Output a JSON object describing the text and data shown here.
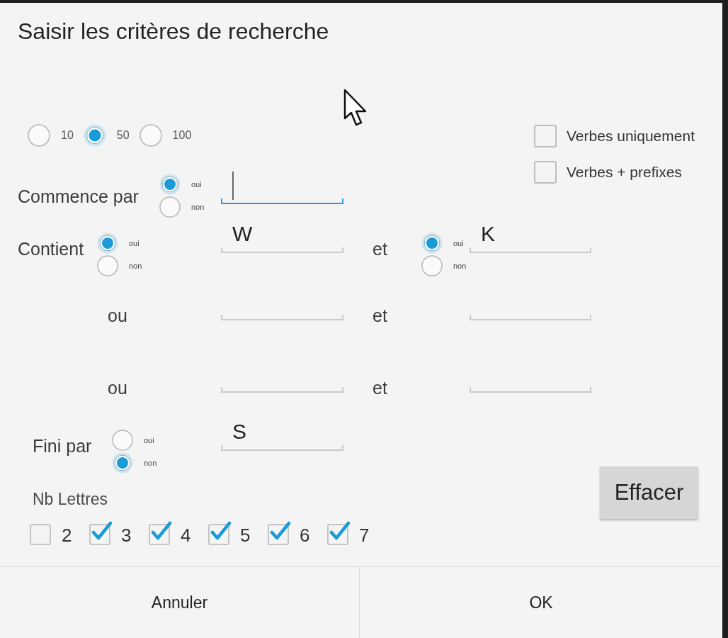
{
  "dialog": {
    "title": "Saisir les critères de recherche"
  },
  "result_limit": [
    {
      "label": "10",
      "selected": false
    },
    {
      "label": "50",
      "selected": true
    },
    {
      "label": "100",
      "selected": false
    }
  ],
  "filters": [
    {
      "label": "Verbes uniquement",
      "checked": false
    },
    {
      "label": "Verbes + prefixes",
      "checked": false
    }
  ],
  "starts_with": {
    "label": "Commence par",
    "options": [
      {
        "label": "oui",
        "selected": true
      },
      {
        "label": "non",
        "selected": false
      }
    ],
    "field": {
      "focused": true
    }
  },
  "contains": [
    {
      "label": "Contient",
      "options": [
        {
          "label": "oui",
          "selected": true
        },
        {
          "label": "non",
          "selected": false
        }
      ],
      "field": {
        "value": "W",
        "focused": false
      },
      "and": {
        "label": "et",
        "options": [
          {
            "label": "oui",
            "selected": true
          },
          {
            "label": "non",
            "selected": false
          }
        ],
        "field": {
          "value": "K",
          "focused": false
        }
      }
    },
    {
      "label": "ou",
      "field": {
        "focused": false
      },
      "and": {
        "label": "et",
        "field": {
          "focused": false
        }
      }
    },
    {
      "label": "ou",
      "field": {
        "focused": false
      },
      "and": {
        "label": "et",
        "field": {
          "focused": false
        }
      }
    }
  ],
  "ends_with": {
    "label": "Fini par",
    "options": [
      {
        "label": "oui",
        "selected": false
      },
      {
        "label": "non",
        "selected": true
      }
    ],
    "field": {
      "value": "S",
      "focused": false
    }
  },
  "letter_count": {
    "label": "Nb Lettres",
    "options": [
      {
        "label": "2",
        "checked": false
      },
      {
        "label": "3",
        "checked": true
      },
      {
        "label": "4",
        "checked": true
      },
      {
        "label": "5",
        "checked": true
      },
      {
        "label": "6",
        "checked": true
      },
      {
        "label": "7",
        "checked": true
      }
    ]
  },
  "clear_button": "Effacer",
  "buttons": [
    "Annuler",
    "OK"
  ]
}
